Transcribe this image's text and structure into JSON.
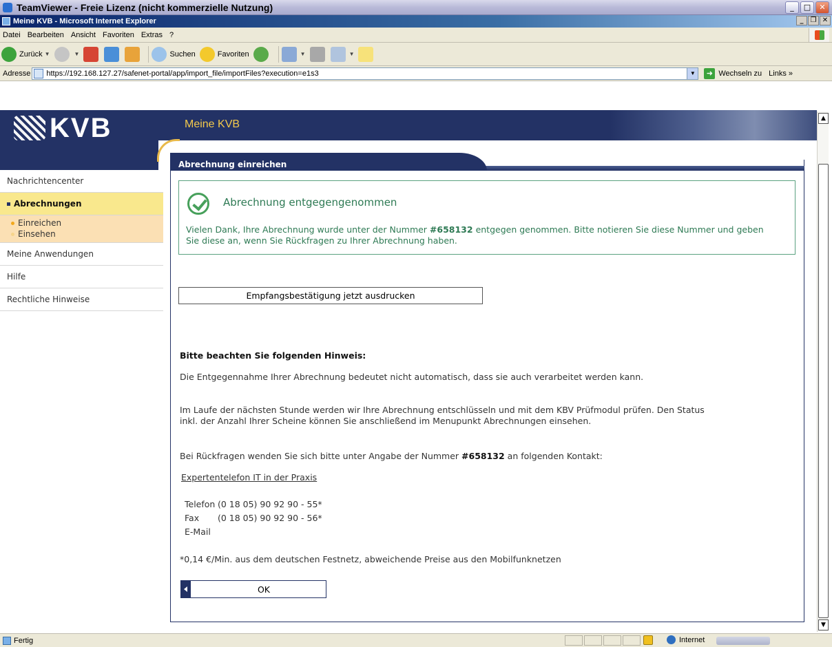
{
  "teamviewer": {
    "title": "TeamViewer - Freie Lizenz (nicht kommerzielle Nutzung)"
  },
  "ie": {
    "title": "Meine KVB - Microsoft Internet Explorer",
    "menu": [
      "Datei",
      "Bearbeiten",
      "Ansicht",
      "Favoriten",
      "Extras",
      "?"
    ],
    "toolbar": {
      "back": "Zurück",
      "search": "Suchen",
      "favorites": "Favoriten"
    },
    "address": {
      "label": "Adresse",
      "url": "https://192.168.127.27/safenet-portal/app/import_file/importFiles?execution=e1s3",
      "go": "Wechseln zu",
      "links": "Links"
    },
    "status": {
      "text": "Fertig",
      "zone": "Internet"
    }
  },
  "header": {
    "logo": "KVB",
    "site_title": "Meine KVB"
  },
  "sidebar": {
    "items": [
      {
        "label": "Nachrichtencenter"
      },
      {
        "label": "Abrechnungen"
      },
      {
        "label": "Meine Anwendungen"
      },
      {
        "label": "Hilfe"
      },
      {
        "label": "Rechtliche Hinweise"
      }
    ],
    "sub": [
      "Einreichen",
      "Einsehen"
    ]
  },
  "panel": {
    "title": "Abrechnung einreichen"
  },
  "success": {
    "heading": "Abrechnung entgegengenommen",
    "msg_pre": "Vielen Dank, Ihre Abrechnung wurde unter der Nummer ",
    "number": "#658132",
    "msg_post": " entgegen genommen. Bitte notieren Sie diese Nummer und geben Sie diese an, wenn Sie Rückfragen zu Ihrer Abrechnung haben."
  },
  "print_button": "Empfangsbestätigung jetzt ausdrucken",
  "notes": {
    "title": "Bitte beachten Sie folgenden Hinweis:",
    "p1": "Die Entgegennahme Ihrer Abrechnung bedeutet nicht automatisch, dass sie auch verarbeitet werden kann.",
    "p2": "Im Laufe der nächsten Stunde werden wir Ihre Abrechnung entschlüsseln und mit dem KBV Prüfmodul prüfen. Den Status inkl. der Anzahl Ihrer Scheine können Sie anschließend im Menupunkt Abrechnungen einsehen.",
    "p3_pre": "Bei Rückfragen wenden Sie sich bitte unter Angabe der Nummer ",
    "p3_number": "#658132",
    "p3_post": " an folgenden Kontakt:",
    "contact_link": "Expertentelefon IT in der Praxis",
    "contact": {
      "phone_label": "Telefon",
      "phone": "(0 18 05) 90 92 90 - 55*",
      "fax_label": "Fax",
      "fax": "(0 18 05) 90 92 90 - 56*",
      "email_label": "E-Mail"
    },
    "footnote": "*0,14 €/Min. aus dem deutschen Festnetz, abweichende Preise aus den Mobilfunknetzen"
  },
  "ok_button": "OK"
}
